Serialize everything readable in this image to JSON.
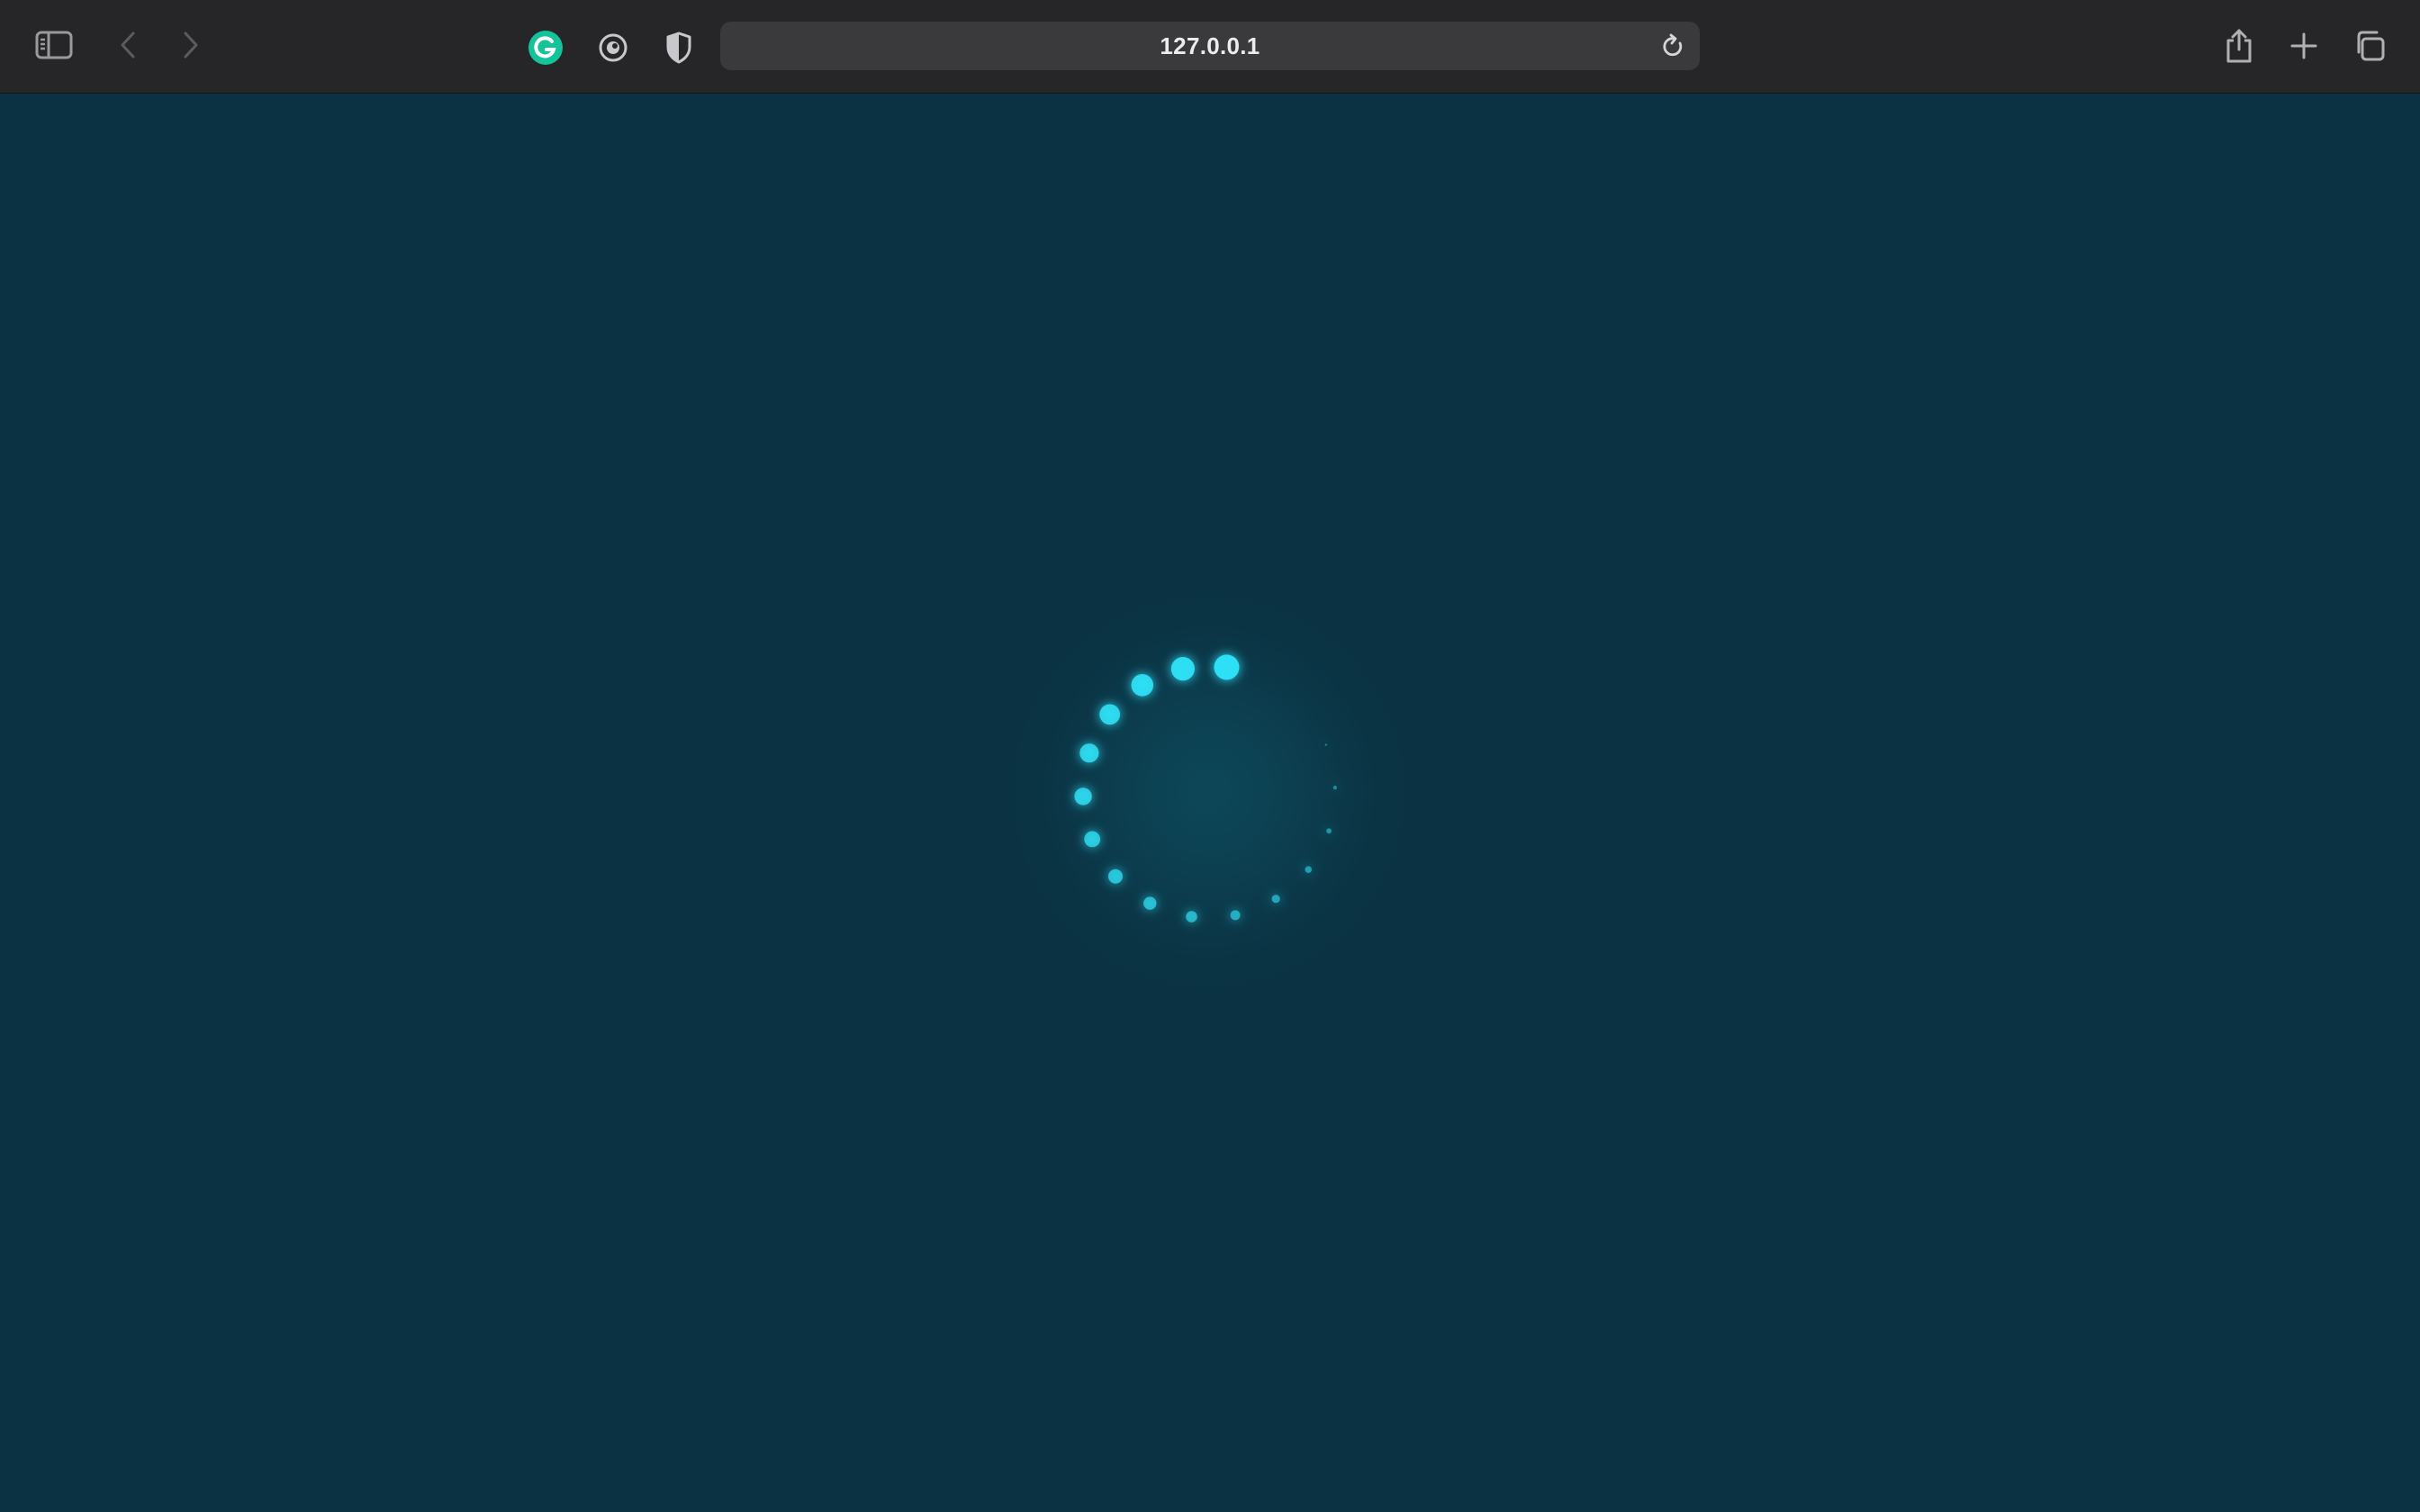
{
  "browser": {
    "address_text": "127.0.0.1",
    "icons": {
      "sidebar": "sidebar-icon",
      "back": "chevron-left-icon",
      "forward": "chevron-right-icon",
      "grammarly": "grammarly-extension-icon",
      "extension": "extension-icon",
      "privacy": "shield-icon",
      "reload": "reload-icon",
      "share": "share-icon",
      "new_tab": "plus-icon",
      "tabs": "tab-overview-icon"
    },
    "colors": {
      "toolbar": "#262628",
      "address_bar": "#3a3a3c",
      "grammarly": "#15c39a"
    }
  },
  "page": {
    "background": "#0a3242",
    "loader": {
      "dot_color": "#2fe0f5",
      "dot_count": 18,
      "visible_dots": 16
    }
  }
}
